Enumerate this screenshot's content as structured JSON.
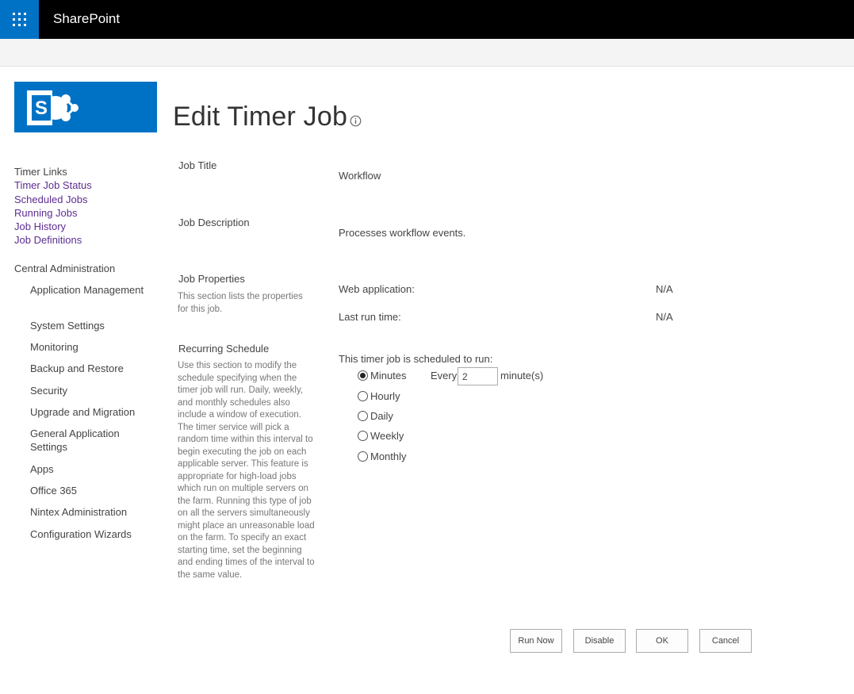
{
  "suite_bar": {
    "brand": "SharePoint",
    "waffle_icon": "app-launcher-icon",
    "background": "#000000",
    "waffle_color": "#0072c6"
  },
  "logo": {
    "icon": "sharepoint-logo-icon",
    "color": "#0072c6",
    "letter": "S"
  },
  "page": {
    "title": "Edit Timer Job",
    "info_icon": "info-icon"
  },
  "left_nav": {
    "timer_links_heading": "Timer Links",
    "timer_links": [
      "Timer Job Status",
      "Scheduled Jobs",
      "Running Jobs",
      "Job History",
      "Job Definitions"
    ],
    "central_admin_heading": "Central Administration",
    "central_admin_items": [
      "Application Management",
      "System Settings",
      "Monitoring",
      "Backup and Restore",
      "Security",
      "Upgrade and Migration",
      "General Application Settings",
      "Apps",
      "Office 365",
      "Nintex Administration",
      "Configuration Wizards"
    ],
    "link_color": "#5c2d91"
  },
  "form": {
    "job_title": {
      "label": "Job Title",
      "value": "Workflow"
    },
    "job_description": {
      "label": "Job Description",
      "value": "Processes workflow events."
    },
    "job_properties": {
      "label": "Job Properties",
      "description": "This section lists the properties for this job.",
      "web_application_label": "Web application:",
      "web_application_value": "N/A",
      "last_run_label": "Last run time:",
      "last_run_value": "N/A"
    },
    "recurring_schedule": {
      "label": "Recurring Schedule",
      "description": "Use this section to modify the schedule specifying when the timer job will run. Daily, weekly, and monthly schedules also include a window of execution. The timer service will pick a random time within this interval to begin executing the job on each applicable server. This feature is appropriate for high-load jobs which run on multiple servers on the farm. Running this type of job on all the servers simultaneously might place an unreasonable load on the farm. To specify an exact starting time, set the beginning and ending times of the interval to the same value.",
      "prompt": "This timer job is scheduled to run:",
      "options": [
        "Minutes",
        "Hourly",
        "Daily",
        "Weekly",
        "Monthly"
      ],
      "selected": "Minutes",
      "every_label": "Every",
      "every_value": "2",
      "unit_label": "minute(s)"
    }
  },
  "buttons": {
    "run_now": "Run Now",
    "disable": "Disable",
    "ok": "OK",
    "cancel": "Cancel"
  }
}
